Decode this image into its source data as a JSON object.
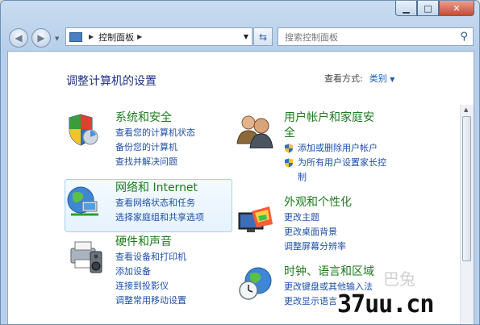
{
  "window": {
    "buttons": {
      "minimize": "▁",
      "maximize": "□",
      "close": "✕"
    }
  },
  "nav": {
    "back_icon": "back-arrow-icon",
    "forward_icon": "forward-arrow-icon",
    "address_root": "控制面板",
    "search_placeholder": "搜索控制面板"
  },
  "content": {
    "heading": "调整计算机的设置",
    "view_by_label": "查看方式:",
    "view_by_value": "类别"
  },
  "categories": {
    "system": {
      "title": "系统和安全",
      "links": [
        "查看您的计算机状态",
        "备份您的计算机",
        "查找并解决问题"
      ]
    },
    "network": {
      "title": "网络和 Internet",
      "links": [
        "查看网络状态和任务",
        "选择家庭组和共享选项"
      ]
    },
    "hardware": {
      "title": "硬件和声音",
      "links": [
        "查看设备和打印机",
        "添加设备",
        "连接到投影仪",
        "调整常用移动设置"
      ]
    },
    "users": {
      "title_line1": "用户帐户和家庭安",
      "title_line2": "全",
      "links": [
        "添加或删除用户帐户",
        "为所有用户设置家长控",
        "制"
      ]
    },
    "appearance": {
      "title": "外观和个性化",
      "links": [
        "更改主题",
        "更改桌面背景",
        "调整屏幕分辨率"
      ]
    },
    "clock": {
      "title": "时钟、语言和区域",
      "links": [
        "更改键盘或其他输入法",
        "更改显示语言"
      ]
    }
  },
  "watermark": {
    "site": "37uu.cn",
    "faint": "巴兔"
  },
  "colors": {
    "title_green": "#1d7a1d",
    "link_blue": "#1e4fa8",
    "heading_blue": "#1e3287"
  }
}
